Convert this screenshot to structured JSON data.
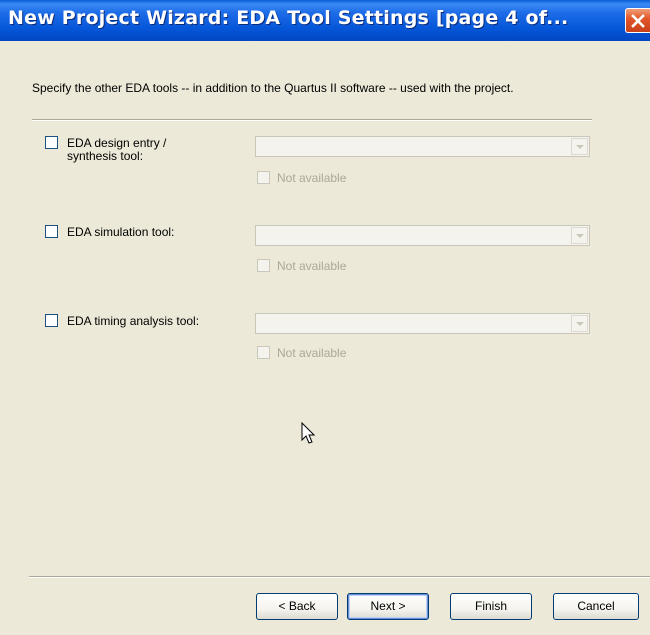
{
  "window": {
    "title": "New Project Wizard: EDA Tool Settings [page 4 of..."
  },
  "description": "Specify the other EDA tools -- in addition to the Quartus II software -- used with the project.",
  "tools": [
    {
      "label_line1": "EDA design entry /",
      "label_line2": "synthesis tool:",
      "checked": false,
      "combo_value": "",
      "not_available_label": "Not available"
    },
    {
      "label_line1": "EDA simulation tool:",
      "checked": false,
      "combo_value": "",
      "not_available_label": "Not available"
    },
    {
      "label_line1": "EDA timing analysis tool:",
      "checked": false,
      "combo_value": "",
      "not_available_label": "Not available"
    }
  ],
  "buttons": {
    "back": "< Back",
    "next": "Next >",
    "finish": "Finish",
    "cancel": "Cancel"
  }
}
